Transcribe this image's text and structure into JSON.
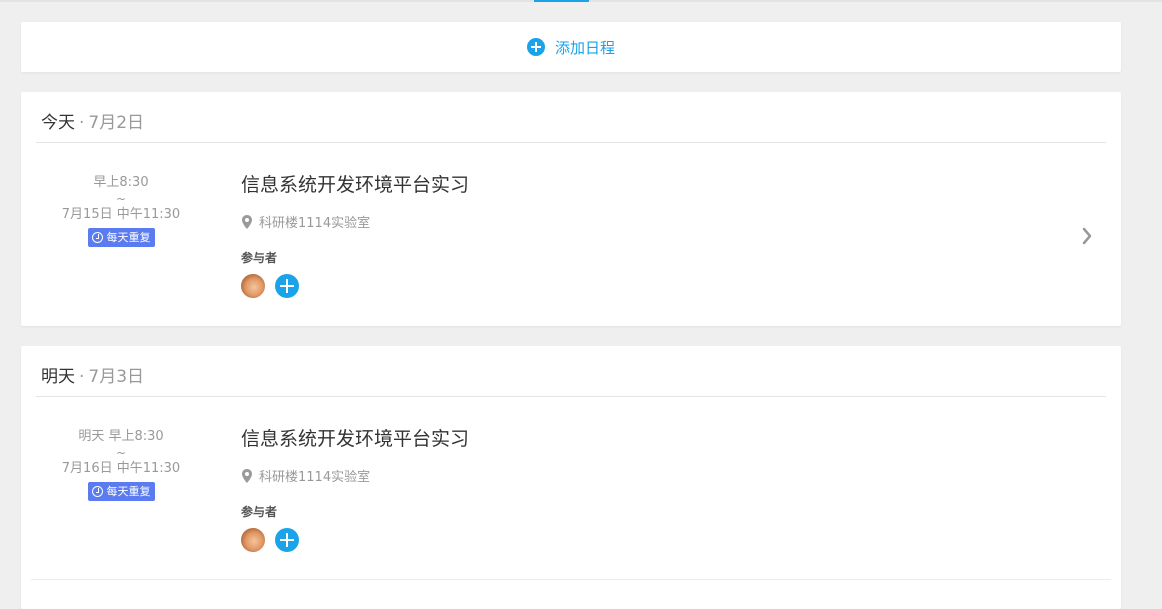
{
  "add_schedule": {
    "label": "添加日程"
  },
  "days": [
    {
      "day_word": "今天",
      "separator": "·",
      "date": "7月2日",
      "event": {
        "start": "早上8:30",
        "tilde": "~",
        "end": "7月15日 中午11:30",
        "repeat": "每天重复",
        "title": "信息系统开发环境平台实习",
        "location": "科研楼1114实验室",
        "participants_label": "参与者"
      }
    },
    {
      "day_word": "明天",
      "separator": "·",
      "date": "7月3日",
      "event": {
        "start": "明天 早上8:30",
        "tilde": "~",
        "end": "7月16日 中午11:30",
        "repeat": "每天重复",
        "title": "信息系统开发环境平台实习",
        "location": "科研楼1114实验室",
        "participants_label": "参与者"
      }
    }
  ],
  "colors": {
    "accent": "#1aa3e8",
    "repeat_badge": "#5b7cf0",
    "background": "#efefef"
  }
}
